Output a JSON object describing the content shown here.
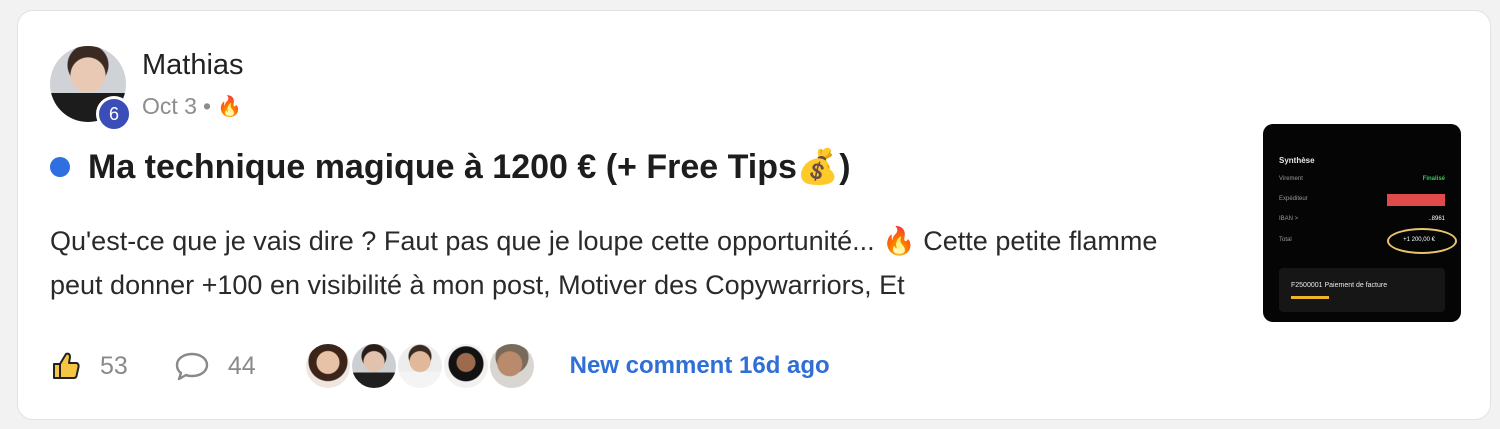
{
  "post": {
    "author": {
      "name": "Mathias",
      "level": "6",
      "date": "Oct 3",
      "separator": "•",
      "reaction_icon": "fire-icon"
    },
    "title": {
      "text": "Ma technique magique à 1200 € (+ Free Tips💰)",
      "unread_dot_color": "#2f6fe0"
    },
    "body": "Qu'est-ce que je vais dire ? Faut pas que je loupe cette opportunité... 🔥 Cette petite flamme peut donner +100 en visibilité à mon post, Motiver des Copywarriors, Et",
    "thumbnail": {
      "heading": "Synthèse",
      "rows": [
        {
          "label": "Virement",
          "value": "Finalisé"
        },
        {
          "label": "Expéditeur",
          "value": ""
        },
        {
          "label": "IBAN  >",
          "value": "..8961"
        },
        {
          "label": "Total",
          "value": "+1 200,00 €"
        }
      ],
      "panel_text": "F2500001 Paiement de facture"
    },
    "footer": {
      "likes": "53",
      "comments": "44",
      "like_icon": "thumbs-up-icon",
      "comment_icon": "comment-bubble-icon",
      "commenter_avatars": [
        "commenter-avatar-1",
        "commenter-avatar-2",
        "commenter-avatar-3",
        "commenter-avatar-4",
        "commenter-avatar-5"
      ],
      "new_comment_text": "New comment 16d ago",
      "accent_color": "#2f6fd6"
    }
  }
}
